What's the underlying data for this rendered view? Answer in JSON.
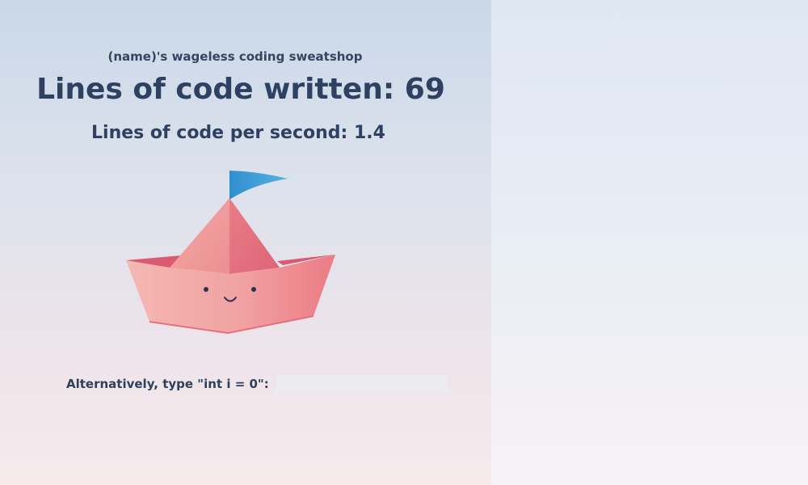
{
  "header": {
    "shop_title": "(name)'s wageless coding sweatshop",
    "lines_written_text": "Lines of code written: 69",
    "lines_per_second_text": "Lines of code per second: 1.4"
  },
  "stats": {
    "lines_written": 69,
    "lines_per_second": 1.4
  },
  "alternative": {
    "label": "Alternatively, type \"int i = 0\":",
    "input_value": ""
  },
  "colors": {
    "text_dark": "#2e4161",
    "boat_pink": "#f2a3a4",
    "boat_dark": "#d95f73",
    "flag_blue": "#3b9bd4"
  },
  "icons": {
    "clicker": "paper-boat-icon"
  }
}
